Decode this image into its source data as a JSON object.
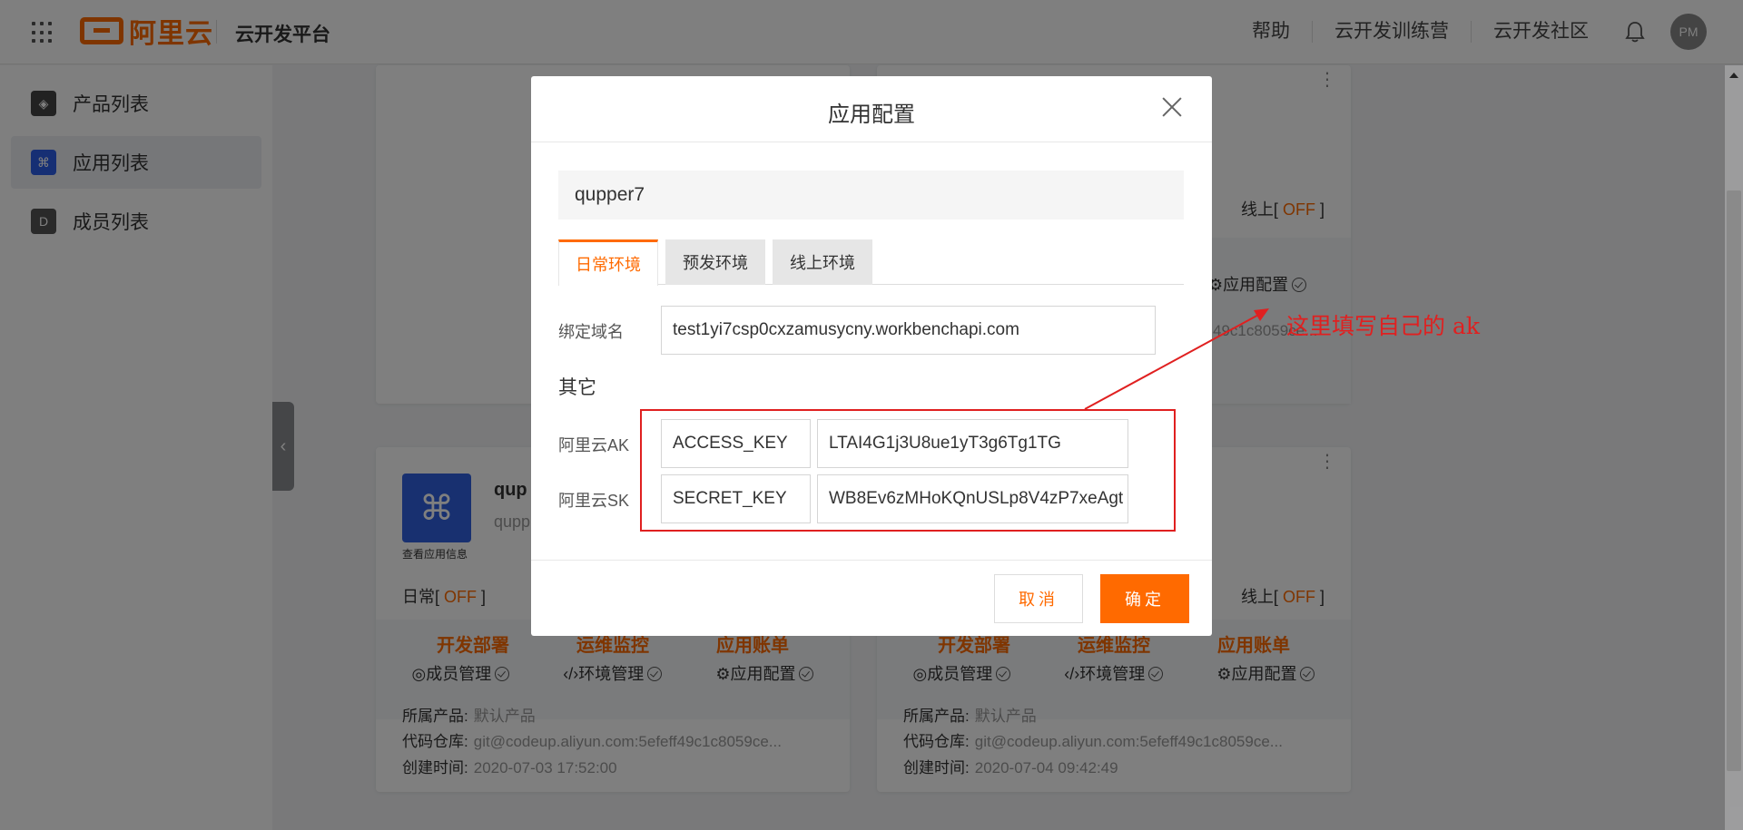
{
  "header": {
    "logo_text": "阿里云",
    "platform_title": "云开发平台",
    "links": [
      "帮助",
      "云开发训练营",
      "云开发社区"
    ],
    "avatar_initials": "PM",
    "accent_color": "#ff6a00"
  },
  "sidebar": {
    "items": [
      {
        "label": "产品列表",
        "icon": "product-icon"
      },
      {
        "label": "应用列表",
        "icon": "app-grid-icon"
      },
      {
        "label": "成员列表",
        "icon": "member-icon"
      }
    ]
  },
  "cards": {
    "top_right": {
      "env_online": "线上[",
      "env_online_state": "OFF",
      "env_online_close": "]",
      "config_label": "应用配置",
      "repo": "49c1c8059ce..."
    },
    "bottom_left": {
      "app_name": "qup",
      "app_sub": "qupp",
      "info_link": "查看应用信息",
      "env_daily": "日常[",
      "env_daily_state": "OFF",
      "env_daily_close": "]",
      "actions": [
        "开发部署",
        "运维监控",
        "应用账单"
      ],
      "manage": [
        "成员管理",
        "环境管理",
        "应用配置"
      ],
      "product_label": "所属产品:",
      "product_value": "默认产品",
      "repo_label": "代码仓库:",
      "repo_value": "git@codeup.aliyun.com:5efeff49c1c8059ce...",
      "created_label": "创建时间:",
      "created_value": "2020-07-03 17:52:00"
    },
    "bottom_right": {
      "env_online": "线上[",
      "env_online_state": "OFF",
      "env_online_close": "]",
      "actions": [
        "开发部署",
        "运维监控",
        "应用账单"
      ],
      "manage": [
        "成员管理",
        "环境管理",
        "应用配置"
      ],
      "product_label": "所属产品:",
      "product_value": "默认产品",
      "repo_label": "代码仓库:",
      "repo_value": "git@codeup.aliyun.com:5efeff49c1c8059ce...",
      "created_label": "创建时间:",
      "created_value": "2020-07-04 09:42:49"
    }
  },
  "modal": {
    "title": "应用配置",
    "app_name": "qupper7",
    "tabs": [
      "日常环境",
      "预发环境",
      "线上环境"
    ],
    "active_tab": 0,
    "domain_label": "绑定域名",
    "domain_value": "test1yi7csp0cxzamusycny.workbenchapi.com",
    "other_section": "其它",
    "ak_label": "阿里云AK",
    "ak_key": "ACCESS_KEY",
    "ak_value": "LTAI4G1j3U8ue1yT3g6Tg1TG",
    "sk_label": "阿里云SK",
    "sk_key": "SECRET_KEY",
    "sk_value": "WB8Ev6zMHoKQnUSLp8V4zP7xeAgt",
    "cancel_label": "取消",
    "ok_label": "确定"
  },
  "annotation": {
    "text": "这里填写自己的 ak",
    "color": "#e02020"
  }
}
